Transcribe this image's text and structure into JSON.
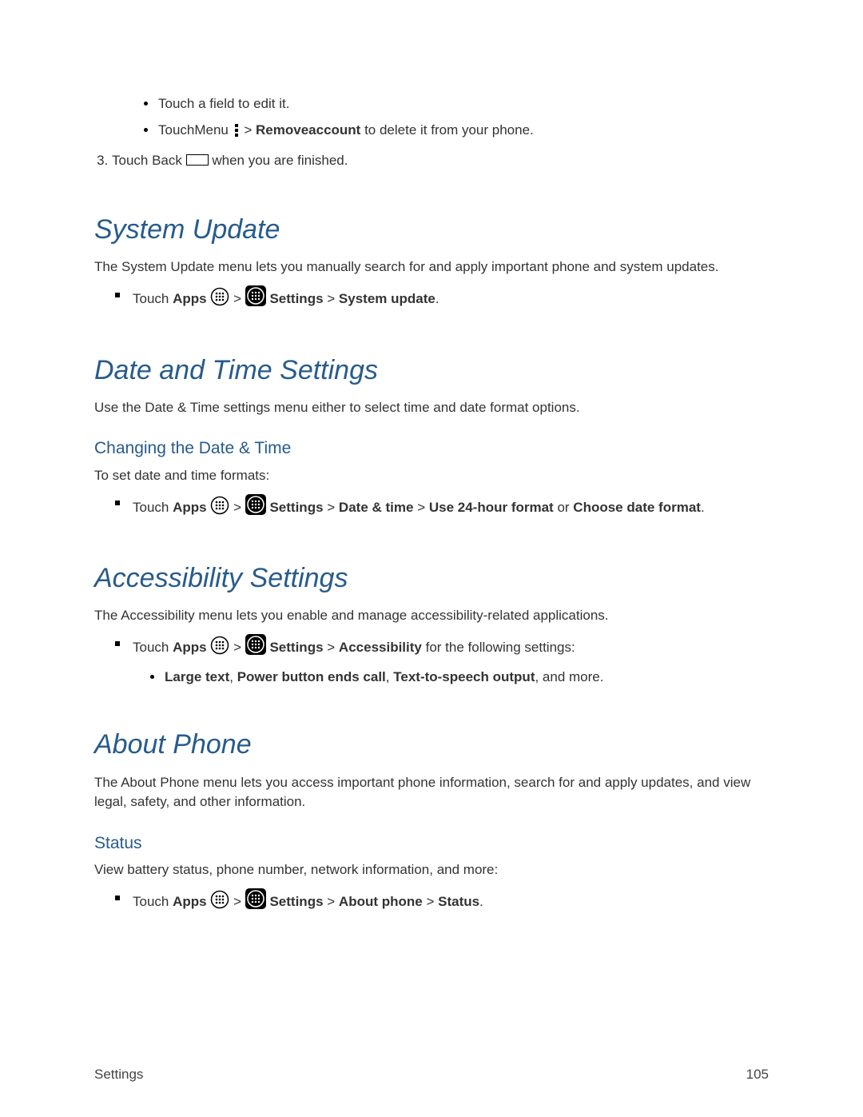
{
  "intro": {
    "bullet1": "Touch a field to edit it.",
    "bullet2_a": "TouchMenu",
    "bullet2_b": " > ",
    "bullet2_bold": "Removeaccount",
    "bullet2_c": " to delete it from your phone.",
    "step3_a": "Touch Back",
    "step3_b": "when you are finished."
  },
  "system_update": {
    "title": "System Update",
    "desc": "The System Update menu lets you manually search for and apply important phone and system updates.",
    "nav_touch": "Touch",
    "nav_apps": "Apps",
    "sep": " > ",
    "nav_settings": "Settings",
    "nav_end": "System update",
    "period": "."
  },
  "date_time": {
    "title": "Date and Time Settings",
    "desc": "Use the Date & Time settings menu either to select time and date format options.",
    "sub": "Changing the Date & Time",
    "intro": "To set date and time formats:",
    "nav_touch": "Touch",
    "nav_apps": "Apps",
    "sep": " > ",
    "nav_settings": "Settings",
    "nav_dt": "Date & time",
    "nav_24h": "Use 24-hour format",
    "or": " or ",
    "nav_choose": "Choose date format",
    "period": "."
  },
  "accessibility": {
    "title": "Accessibility Settings",
    "desc": "The Accessibility menu lets you enable and manage accessibility-related applications.",
    "nav_touch": "Touch",
    "nav_apps": "Apps",
    "sep": " > ",
    "nav_settings": "Settings",
    "nav_acc": "Accessibility",
    "tail": " for the following settings:",
    "opts_large": "Large text",
    "comma": ", ",
    "opts_power": "Power button ends call",
    "opts_tts": "Text-to-speech output",
    "opts_end": ", and more."
  },
  "about": {
    "title": "About Phone",
    "desc": "The About Phone menu lets you access important phone information, search for and apply updates, and view legal, safety, and other information.",
    "sub": "Status",
    "intro": "View battery status, phone number, network information, and more:",
    "nav_touch": "Touch",
    "nav_apps": "Apps",
    "sep": " > ",
    "nav_settings": "Settings",
    "nav_about": "About phone",
    "nav_status": "Status",
    "period": "."
  },
  "footer": {
    "left": "Settings",
    "right": "105"
  }
}
